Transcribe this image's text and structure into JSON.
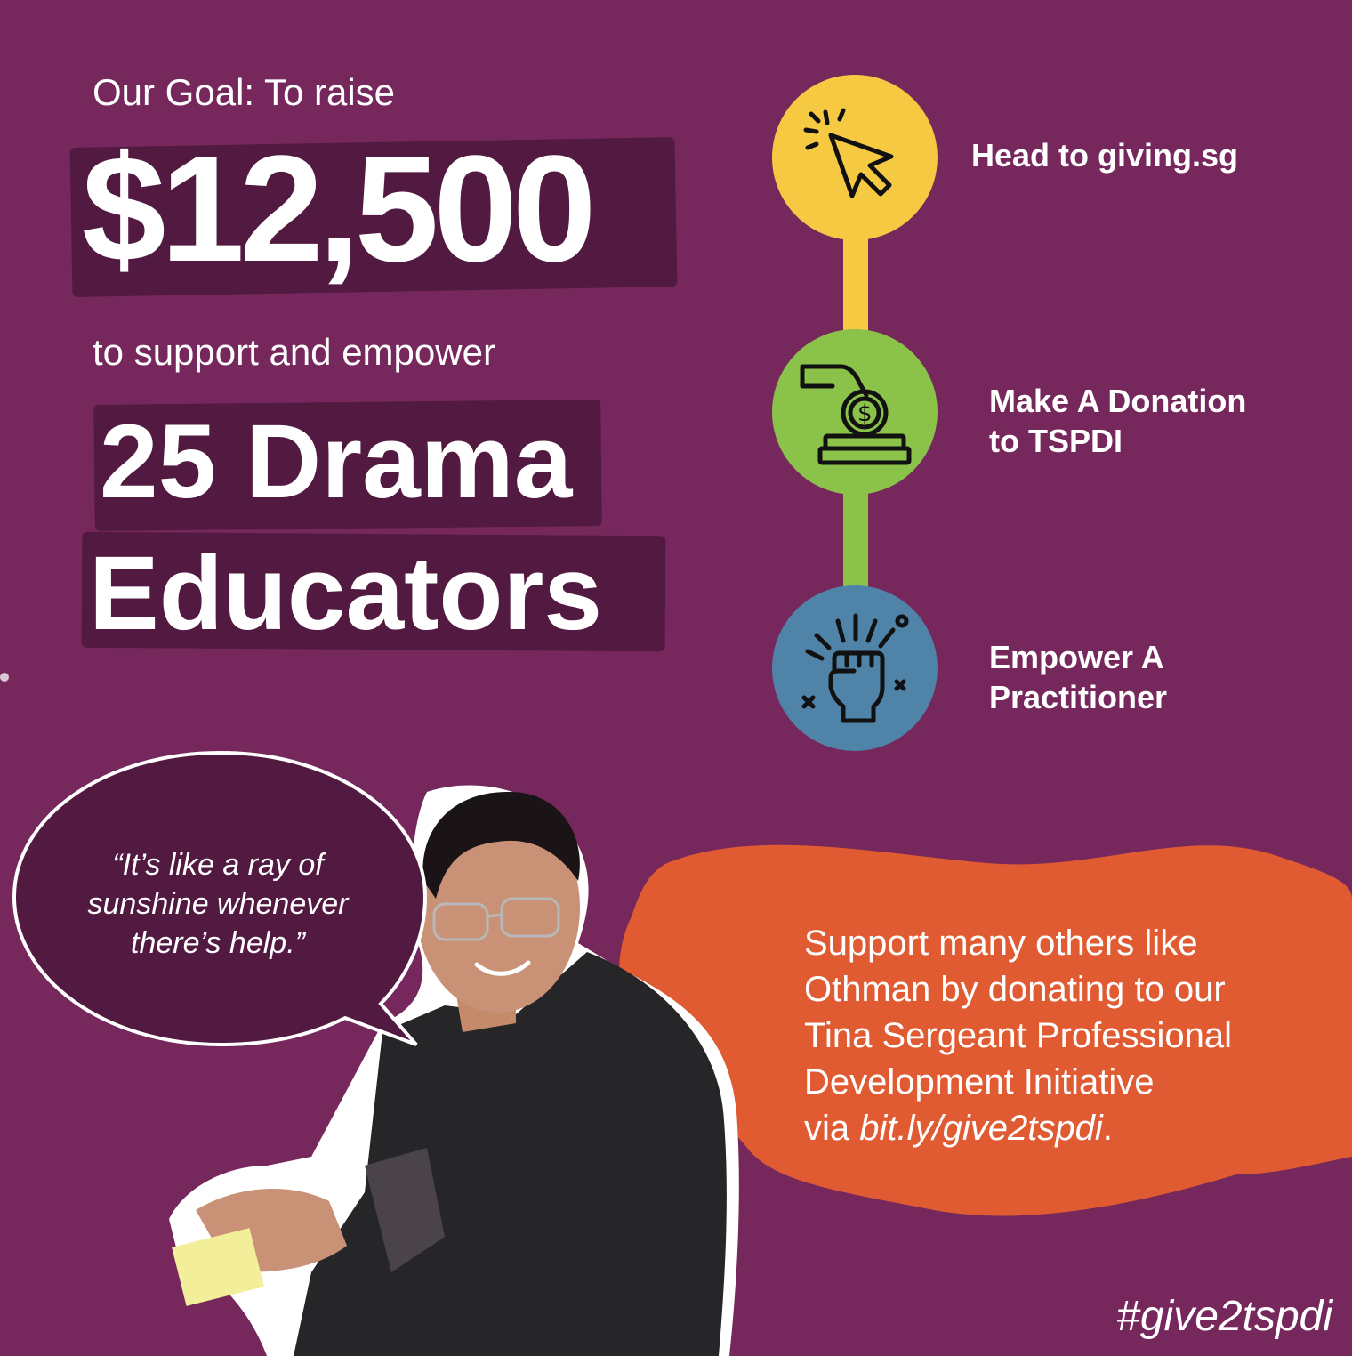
{
  "goal": {
    "intro": "Our Goal: To raise",
    "amount": "$12,500",
    "support": "to support and empower",
    "count_line": "25 Drama",
    "target_line": "Educators"
  },
  "steps": [
    {
      "label_line1": "Head to giving.sg",
      "label_line2": "",
      "color": "#f5c942",
      "icon": "cursor-click-icon"
    },
    {
      "label_line1": "Make A Donation",
      "label_line2": "to TSPDI",
      "color": "#8bc34a",
      "icon": "donation-hand-coin-icon"
    },
    {
      "label_line1": "Empower A",
      "label_line2": "Practitioner",
      "color": "#4f83a8",
      "icon": "raised-fist-icon"
    }
  ],
  "quote": {
    "line1": "“It’s like a ray of",
    "line2": "sunshine whenever",
    "line3": "there’s help.”"
  },
  "cta": {
    "line1": "Support many others like",
    "line2": "Othman by donating to our",
    "line3": "Tina Sergeant Professional",
    "line4": "Development Initiative",
    "line5_prefix": "via ",
    "line5_link": "bit.ly/give2tspdi",
    "line5_suffix": "."
  },
  "hashtag": "#give2tspdi",
  "colors": {
    "background": "#76285d",
    "brush": "#521a41",
    "blob": "#e05a32",
    "yellow": "#f5c942",
    "green": "#8bc34a",
    "blue": "#4f83a8"
  }
}
